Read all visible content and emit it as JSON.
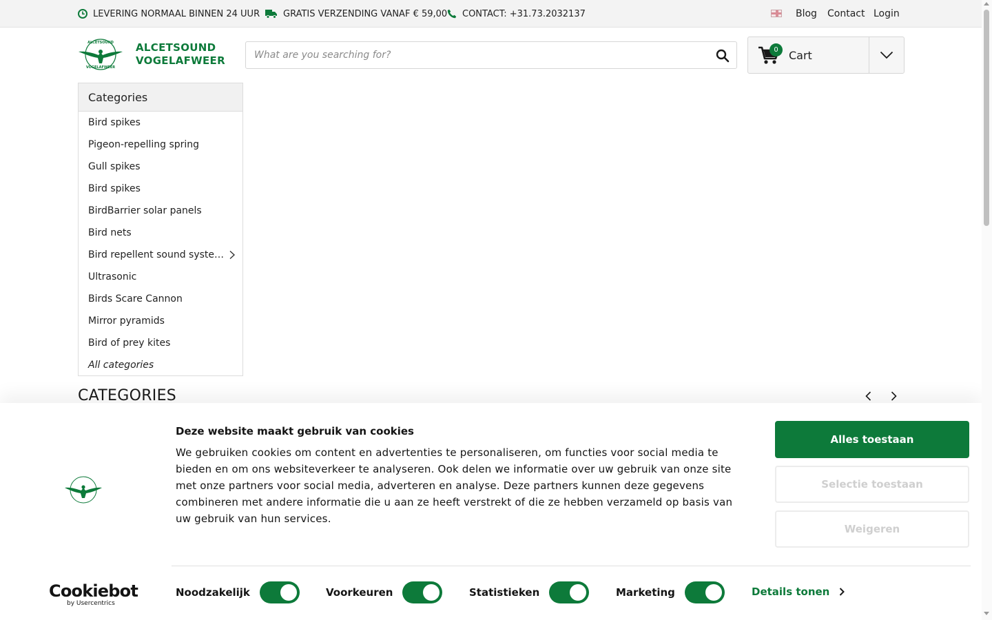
{
  "topbar": {
    "usp1": "LEVERING NORMAAL BINNEN 24 UUR",
    "usp2": "GRATIS VERZENDING VANAF € 59,00",
    "usp3": "CONTACT: +31.73.2032137",
    "links": {
      "blog": "Blog",
      "contact": "Contact",
      "login": "Login"
    }
  },
  "header": {
    "logo_line1": "ALCETSOUND",
    "logo_line2": "VOGELAFWEER",
    "search_placeholder": "What are you searching for?",
    "cart_label": "Cart",
    "cart_count": "0"
  },
  "categories": {
    "title": "Categories",
    "items": [
      "Bird spikes",
      "Pigeon-repelling spring",
      "Gull spikes",
      "Bird spikes",
      "BirdBarrier solar panels",
      "Bird nets",
      "Bird repellent sound syste…",
      "Ultrasonic",
      "Birds Scare Cannon",
      "Mirror pyramids",
      "Bird of prey kites"
    ],
    "all": "All categories"
  },
  "section": {
    "title": "CATEGORIES"
  },
  "cookie": {
    "title": "Deze website maakt gebruik van cookies",
    "text": "We gebruiken cookies om content en advertenties te personaliseren, om functies voor social media te bieden en om ons websiteverkeer te analyseren. Ook delen we informatie over uw gebruik van onze site met onze partners voor social media, adverteren en analyse. Deze partners kunnen deze gegevens combineren met andere informatie die u aan ze heeft verstrekt of die ze hebben verzameld op basis van uw gebruik van hun services.",
    "allow_all": "Alles toestaan",
    "allow_selection": "Selectie toestaan",
    "deny": "Weigeren",
    "toggles": {
      "necessary": "Noodzakelijk",
      "preferences": "Voorkeuren",
      "statistics": "Statistieken",
      "marketing": "Marketing"
    },
    "details": "Details tonen",
    "brand": "Cookiebot",
    "brand_sub": "by Usercentrics"
  },
  "colors": {
    "brand_green": "#0d7a3a"
  }
}
